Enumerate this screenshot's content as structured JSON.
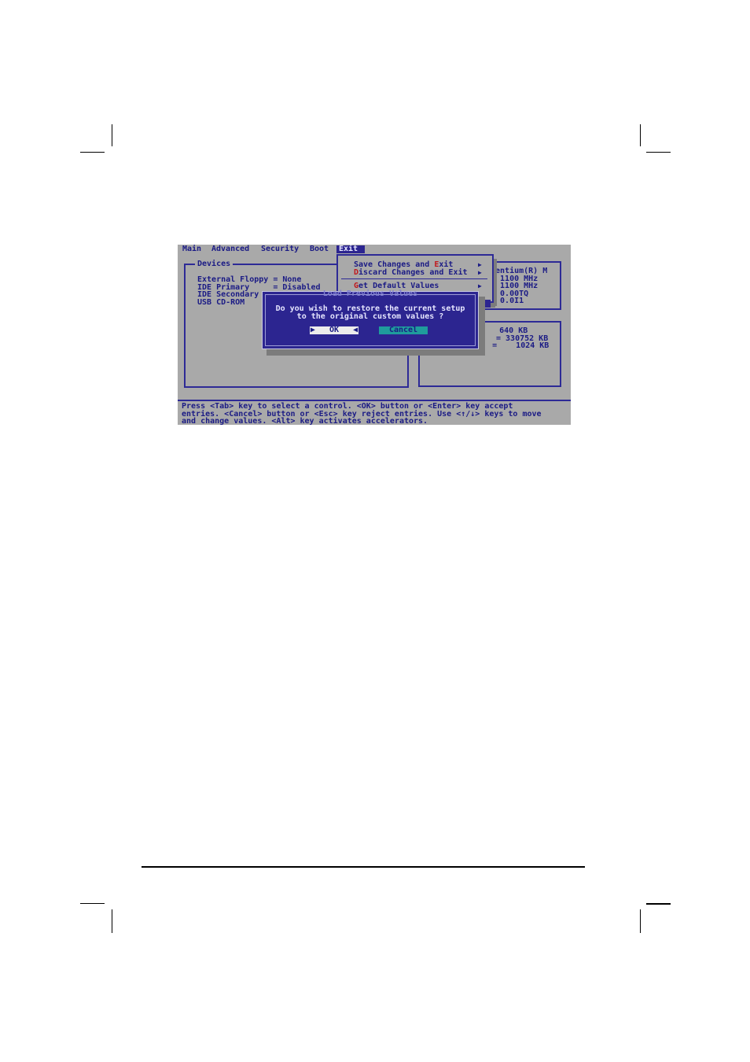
{
  "menu": {
    "items": [
      {
        "label": "Main"
      },
      {
        "label": "Advanced"
      },
      {
        "label": "Security"
      },
      {
        "label": "Boot"
      },
      {
        "label": "Exit"
      }
    ]
  },
  "devices_panel": {
    "title": "Devices",
    "rows": [
      "External Floppy = None",
      "IDE Primary     = Disabled",
      "IDE Secondary",
      "USB CD-ROM      ="
    ]
  },
  "exit_menu": {
    "items": [
      {
        "hot": "",
        "rest": "Save Changes and ",
        "hot2": "E",
        "rest2": "xit"
      },
      {
        "hot": "D",
        "rest": "iscard Changes and Exit",
        "hot2": "",
        "rest2": ""
      },
      {
        "hot": "G",
        "rest": "et Default Values",
        "hot2": "",
        "rest2": ""
      }
    ],
    "arrow": "▶"
  },
  "cpu_panel": {
    "rows": [
      "Pentium(R) M",
      "= 1100 MHz",
      "= 1100 MHz",
      "= 0.00TQ",
      "= 0.0I1"
    ]
  },
  "memory_panel": {
    "rows": [
      "=     640 KB",
      "= 330752 KB",
      "t)  =    1024 KB"
    ]
  },
  "dialog": {
    "title": "Load Previous Values",
    "message_line1": "Do you wish to restore the current setup",
    "message_line2": "to the original custom values ?",
    "ok_label": "▶   OK   ◀",
    "cancel_label": "Cancel"
  },
  "status": {
    "line1": "Press <Tab> key to select a control. <OK> button or <Enter> key accept",
    "line2": "entries. <Cancel> button or <Esc> key reject entries. Use <↑/↓> keys to move",
    "line3": "and change values. <Alt> key activates accelerators."
  }
}
